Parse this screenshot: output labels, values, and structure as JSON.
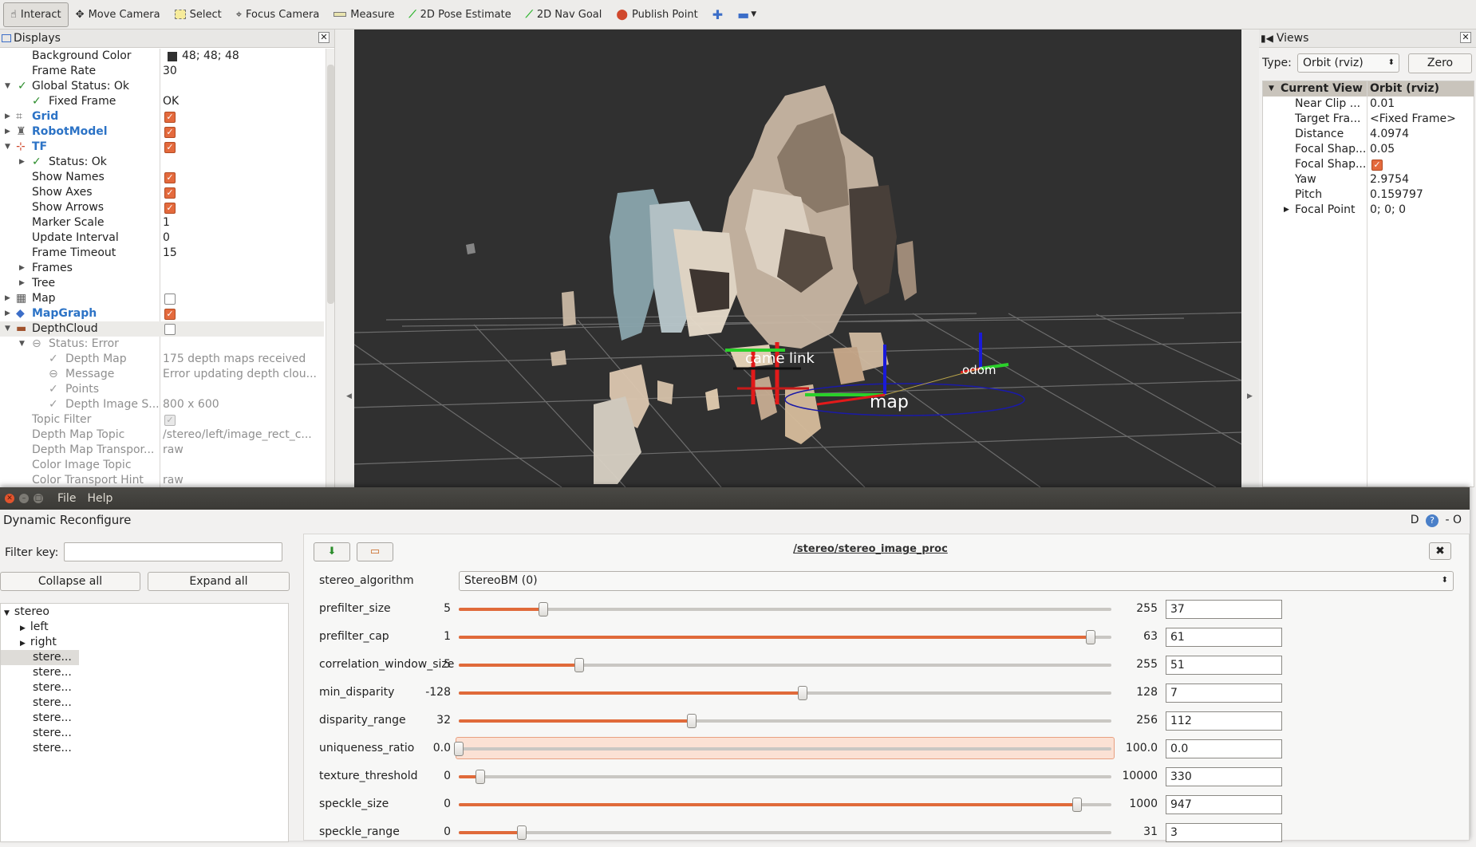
{
  "toolbar": {
    "tools": [
      {
        "label": "Interact",
        "icon": "cursor-icon"
      },
      {
        "label": "Move Camera",
        "icon": "move-camera-icon"
      },
      {
        "label": "Select",
        "icon": "select-icon"
      },
      {
        "label": "Focus Camera",
        "icon": "focus-camera-icon"
      },
      {
        "label": "Measure",
        "icon": "measure-icon"
      },
      {
        "label": "2D Pose Estimate",
        "icon": "pose-estimate-icon"
      },
      {
        "label": "2D Nav Goal",
        "icon": "nav-goal-icon"
      },
      {
        "label": "Publish Point",
        "icon": "publish-point-icon"
      }
    ]
  },
  "displays": {
    "title": "Displays",
    "rows": [
      {
        "name": "Background Color",
        "value": "48; 48; 48"
      },
      {
        "name": "Frame Rate",
        "value": "30"
      },
      {
        "name": "Global Status: Ok",
        "value": ""
      },
      {
        "name": "Fixed Frame",
        "value": "OK"
      },
      {
        "name": "Grid",
        "value": ""
      },
      {
        "name": "RobotModel",
        "value": ""
      },
      {
        "name": "TF",
        "value": ""
      },
      {
        "name": "Status: Ok",
        "value": ""
      },
      {
        "name": "Show Names",
        "value": ""
      },
      {
        "name": "Show Axes",
        "value": ""
      },
      {
        "name": "Show Arrows",
        "value": ""
      },
      {
        "name": "Marker Scale",
        "value": "1"
      },
      {
        "name": "Update Interval",
        "value": "0"
      },
      {
        "name": "Frame Timeout",
        "value": "15"
      },
      {
        "name": "Frames",
        "value": ""
      },
      {
        "name": "Tree",
        "value": ""
      },
      {
        "name": "Map",
        "value": ""
      },
      {
        "name": "MapGraph",
        "value": ""
      },
      {
        "name": "DepthCloud",
        "value": ""
      },
      {
        "name": "Status: Error",
        "value": ""
      },
      {
        "name": "Depth Map",
        "value": "175 depth maps received"
      },
      {
        "name": "Message",
        "value": "Error updating depth clou..."
      },
      {
        "name": "Points",
        "value": ""
      },
      {
        "name": "Depth Image S...",
        "value": "800 x 600"
      },
      {
        "name": "Topic Filter",
        "value": ""
      },
      {
        "name": "Depth Map Topic",
        "value": "/stereo/left/image_rect_c..."
      },
      {
        "name": "Depth Map Transpor...",
        "value": "raw"
      },
      {
        "name": "Color Image Topic",
        "value": ""
      },
      {
        "name": "Color Transport Hint",
        "value": "raw"
      }
    ]
  },
  "scene": {
    "labels": {
      "camera": "came",
      "link": "link",
      "map": "map",
      "odom": "odom"
    }
  },
  "views": {
    "title": "Views",
    "type_label": "Type:",
    "type_value": "Orbit (rviz)",
    "zero_label": "Zero",
    "current_view_label": "Current View",
    "current_view_value": "Orbit (rviz)",
    "props": [
      {
        "key": "Near Clip ...",
        "value": "0.01"
      },
      {
        "key": "Target Fra...",
        "value": "<Fixed Frame>"
      },
      {
        "key": "Distance",
        "value": "4.0974"
      },
      {
        "key": "Focal Shap...",
        "value": "0.05"
      },
      {
        "key": "Focal Shap...",
        "value": ""
      },
      {
        "key": "Yaw",
        "value": "2.9754"
      },
      {
        "key": "Pitch",
        "value": "0.159797"
      },
      {
        "key": "Focal Point",
        "value": "0; 0; 0"
      }
    ]
  },
  "reconfigure": {
    "menu_file": "File",
    "menu_help": "Help",
    "title": "Dynamic Reconfigure",
    "title_right": "D",
    "title_right2": "- O",
    "filter_label": "Filter key:",
    "filter_value": "",
    "collapse_label": "Collapse all",
    "expand_label": "Expand all",
    "tree": [
      {
        "label": "stereo"
      },
      {
        "label": "left"
      },
      {
        "label": "right"
      },
      {
        "label": "stere..."
      },
      {
        "label": "stere..."
      },
      {
        "label": "stere..."
      },
      {
        "label": "stere..."
      },
      {
        "label": "stere..."
      },
      {
        "label": "stere..."
      },
      {
        "label": "stere..."
      }
    ],
    "node_name": "/stereo/stereo_image_proc",
    "algorithm_label": "stereo_algorithm",
    "algorithm_value": "StereoBM (0)",
    "params": [
      {
        "name": "prefilter_size",
        "min": "5",
        "max": "255",
        "value": "37",
        "frac": 0.13
      },
      {
        "name": "prefilter_cap",
        "min": "1",
        "max": "63",
        "value": "61",
        "frac": 0.968
      },
      {
        "name": "correlation_window_size",
        "min": "5",
        "max": "255",
        "value": "51",
        "frac": 0.184
      },
      {
        "name": "min_disparity",
        "min": "-128",
        "max": "128",
        "value": "7",
        "frac": 0.527
      },
      {
        "name": "disparity_range",
        "min": "32",
        "max": "256",
        "value": "112",
        "frac": 0.357
      },
      {
        "name": "uniqueness_ratio",
        "min": "0.0",
        "max": "100.0",
        "value": "0.0",
        "frac": 0.0
      },
      {
        "name": "texture_threshold",
        "min": "0",
        "max": "10000",
        "value": "330",
        "frac": 0.033
      },
      {
        "name": "speckle_size",
        "min": "0",
        "max": "1000",
        "value": "947",
        "frac": 0.947
      },
      {
        "name": "speckle_range",
        "min": "0",
        "max": "31",
        "value": "3",
        "frac": 0.097
      }
    ]
  }
}
